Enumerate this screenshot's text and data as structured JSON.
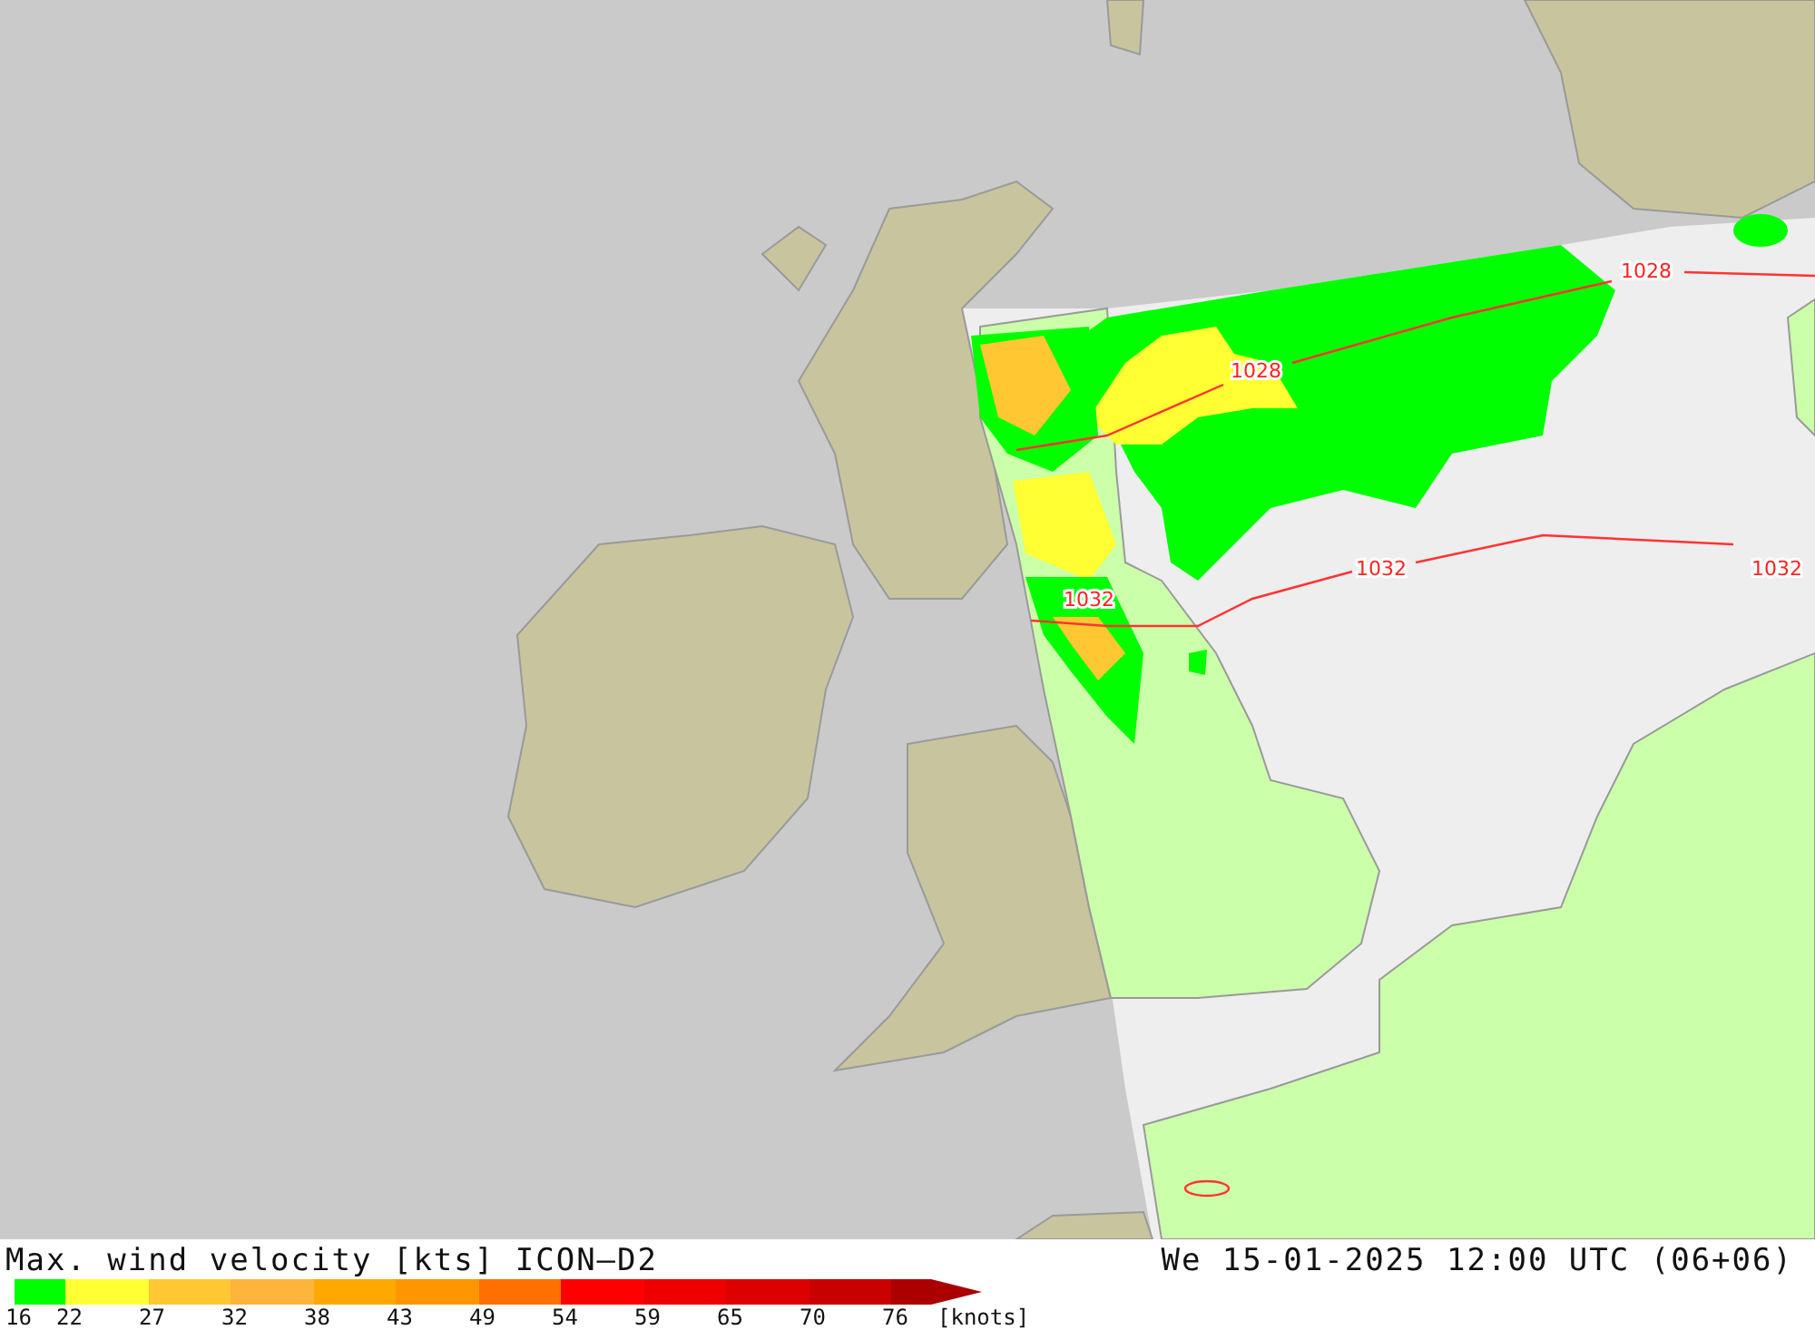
{
  "map": {
    "isobar_labels": [
      "1028",
      "1028",
      "1032",
      "1032",
      "1032"
    ]
  },
  "legend": {
    "title": "Max. wind velocity [kts] ICON—D2",
    "valid_time": "We 15-01-2025 12:00 UTC (06+06)",
    "segments": [
      {
        "color": "#00ff00"
      },
      {
        "color": "#ffff33"
      },
      {
        "color": "#ffc832"
      },
      {
        "color": "#ffb43c"
      },
      {
        "color": "#ffa800"
      },
      {
        "color": "#ff9600"
      },
      {
        "color": "#ff7000"
      },
      {
        "color": "#ff0000"
      },
      {
        "color": "#ee0000"
      },
      {
        "color": "#dd0000"
      },
      {
        "color": "#c80000"
      },
      {
        "color": "#aa0000"
      }
    ],
    "ticks": [
      "16",
      "22",
      "27",
      "32",
      "38",
      "43",
      "49",
      "54",
      "59",
      "65",
      "70",
      "76"
    ],
    "unit": "[knots]"
  }
}
